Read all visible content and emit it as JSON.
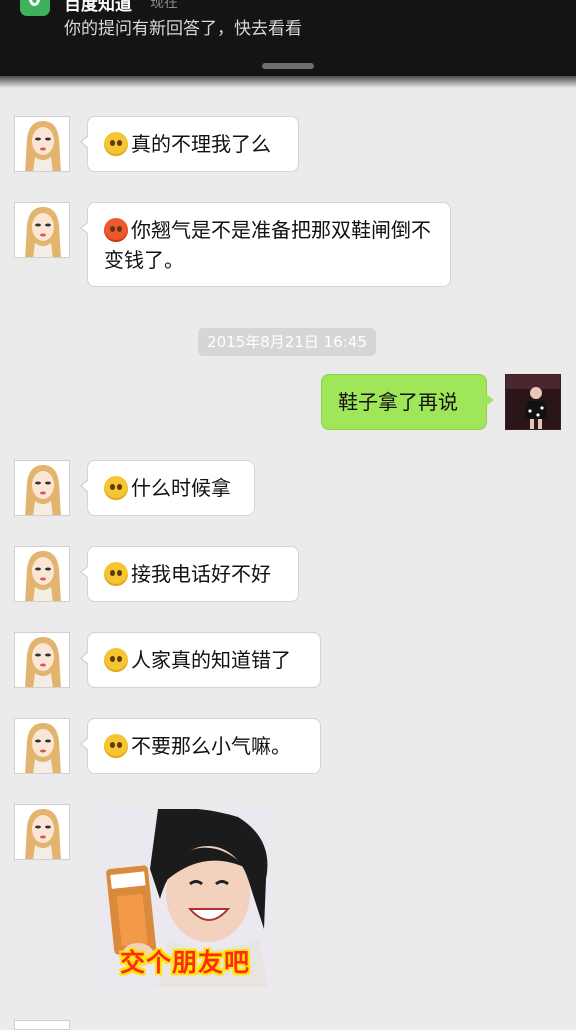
{
  "notification": {
    "app_name": "百度知道",
    "time": "现在",
    "message": "你的提问有新回答了，快去看看"
  },
  "timestamp": "2015年8月21日 16:45",
  "messages": [
    {
      "side": "left",
      "emoji": "flushed-emoji",
      "text": "真的不理我了么"
    },
    {
      "side": "left",
      "emoji": "angry-emoji",
      "text": "你翘气是不是准备把那双鞋闸倒不变钱了。"
    },
    {
      "side": "right",
      "text": "鞋子拿了再说"
    },
    {
      "side": "left",
      "emoji": "pleading-emoji",
      "text": "什么时候拿"
    },
    {
      "side": "left",
      "emoji": "flushed-emoji",
      "text": "接我电话好不好"
    },
    {
      "side": "left",
      "emoji": "hug-emoji",
      "text": "人家真的知道错了"
    },
    {
      "side": "left",
      "emoji": "shy-emoji",
      "text": "不要那么小气嘛。"
    }
  ],
  "sticker": {
    "caption": "交个朋友吧"
  },
  "colors": {
    "chat_background": "#ebebeb",
    "sent_bubble": "#9fe659",
    "received_bubble": "#ffffff",
    "notification_background": "#141414"
  }
}
